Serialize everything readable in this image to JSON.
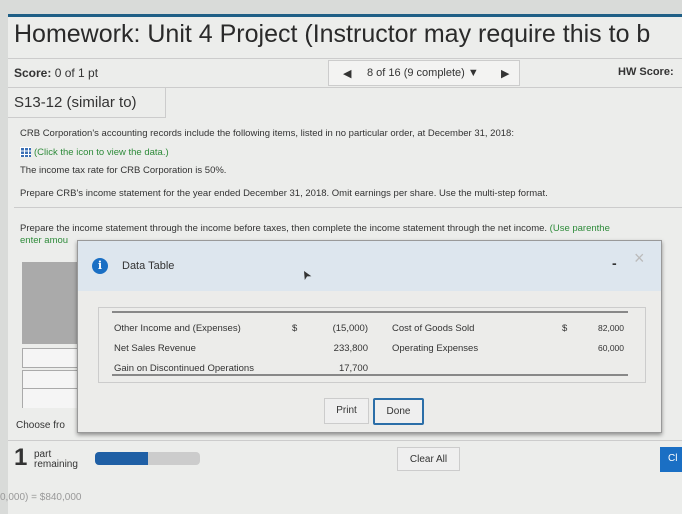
{
  "header": {
    "title": "Homework: Unit 4 Project (Instructor may require this to b",
    "score_label": "Score:",
    "score_value": "0 of 1 pt",
    "nav_text": "8 of 16 (9 complete)",
    "hw_score_label": "HW Score:"
  },
  "question": {
    "id": "S13-12 (similar to)",
    "line1": "CRB Corporation's accounting records include the following items, listed in no particular order, at December 31, 2018:",
    "data_link": "(Click the icon to view the data.)",
    "line2": "The income tax rate for CRB Corporation is 50%.",
    "line3": "Prepare CRB's income statement for the year ended December 31, 2018. Omit earnings per share. Use the multi-step format.",
    "instruction": "Prepare the income statement through the income before taxes, then complete the income statement through the net income.",
    "instruction_hint": "(Use parenthe",
    "enter_partial": "enter amou",
    "choose_partial": "Choose fro"
  },
  "dialog": {
    "title": "Data Table",
    "minimize": "-",
    "close": "×",
    "left_rows": [
      {
        "label": "Other Income and (Expenses)",
        "currency": "$",
        "value": "(15,000)"
      },
      {
        "label": "Net Sales Revenue",
        "currency": "",
        "value": "233,800"
      },
      {
        "label": "Gain on Discontinued Operations",
        "currency": "",
        "value": "17,700"
      }
    ],
    "right_rows": [
      {
        "label": "Cost of Goods Sold",
        "currency": "$",
        "value": "82,000"
      },
      {
        "label": "Operating Expenses",
        "currency": "",
        "value": "60,000"
      }
    ],
    "print": "Print",
    "done": "Done"
  },
  "footer": {
    "parts_count": "1",
    "parts_label1": "part",
    "parts_label2": "remaining",
    "progress_percent": 50,
    "clear_all": "Clear All",
    "check_partial": "Cl",
    "bottom_text": "0,000) = $840,000"
  },
  "colors": {
    "accent": "#1f5fa5",
    "link": "#2e8b3a"
  }
}
